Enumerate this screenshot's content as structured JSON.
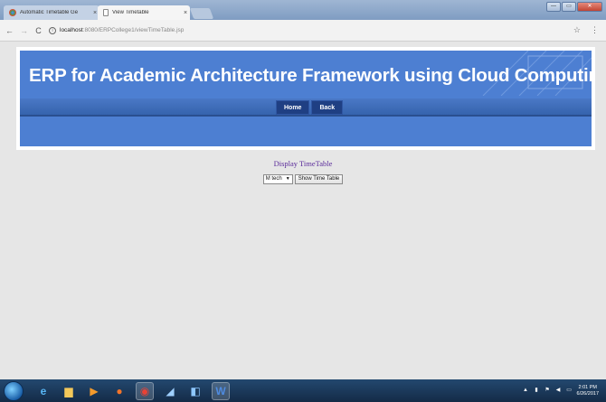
{
  "browser": {
    "tabs": [
      {
        "label": "Automatic Timetable Ge",
        "close": "×"
      },
      {
        "label": "View Timetable",
        "close": "×"
      }
    ],
    "url_host": "localhost",
    "url_path": ":8080/ERPCollege1/viewTimeTable.jsp",
    "info_glyph": "i",
    "window_controls": {
      "minimize": "—",
      "maximize": "▭",
      "close": "✕"
    }
  },
  "header": {
    "title": "ERP for Academic Architecture Framework using Cloud Computing",
    "nav": [
      {
        "label": "Home"
      },
      {
        "label": "Back"
      }
    ]
  },
  "form": {
    "heading": "Display TimeTable",
    "selected_course": "M tech",
    "submit_label": "Show Time Table"
  },
  "taskbar": {
    "time": "2:01 PM",
    "date": "6/26/2017"
  },
  "colors": {
    "banner_blue": "#4d7fd2",
    "nav_dark": "#1f3f83",
    "heading_purple": "#5a2b9a",
    "page_bg": "#e6e6e6"
  },
  "icons": {
    "taskbar": [
      "ie-icon",
      "explorer-folder-icon",
      "media-player-icon",
      "firefox-icon",
      "chrome-icon",
      "app-icon",
      "virtualbox-icon",
      "word-icon"
    ]
  }
}
